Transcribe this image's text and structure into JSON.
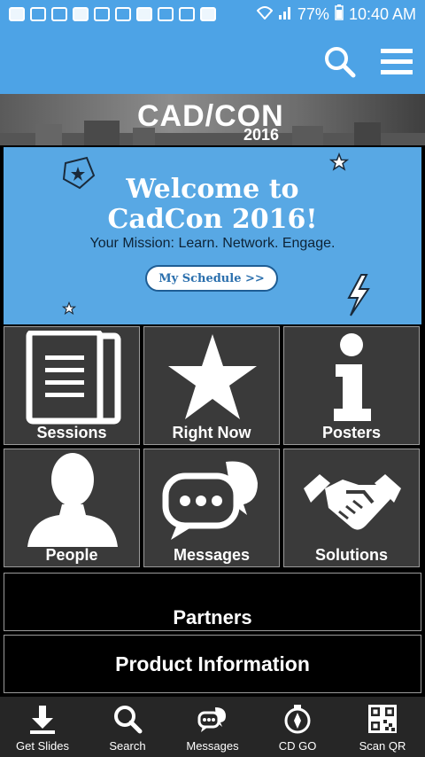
{
  "status": {
    "battery": "77%",
    "time": "10:40 AM"
  },
  "banner": {
    "logo": "CAD/CON",
    "year": "2016"
  },
  "welcome": {
    "title_line1": "Welcome to",
    "title_line2": "CadCon 2016!",
    "subtitle": "Your Mission: Learn. Network. Engage.",
    "button": "My Schedule >>"
  },
  "tiles": [
    {
      "label": "Sessions",
      "icon": "documents-icon"
    },
    {
      "label": "Right Now",
      "icon": "star-icon"
    },
    {
      "label": "Posters",
      "icon": "info-icon"
    },
    {
      "label": "People",
      "icon": "person-icon"
    },
    {
      "label": "Messages",
      "icon": "chat-icon"
    },
    {
      "label": "Solutions",
      "icon": "handshake-icon"
    }
  ],
  "bars": {
    "partners": "Partners",
    "product_info": "Product Information"
  },
  "bottom_nav": [
    {
      "label": "Get Slides",
      "icon": "download-icon"
    },
    {
      "label": "Search",
      "icon": "search-icon"
    },
    {
      "label": "Messages",
      "icon": "chat-icon"
    },
    {
      "label": "CD GO",
      "icon": "compass-icon"
    },
    {
      "label": "Scan QR",
      "icon": "qr-icon"
    }
  ],
  "colors": {
    "accent": "#4da3e6",
    "welcome_bg": "#58a8e4",
    "tile_bg": "#3a3a3a",
    "nav_bg": "#262626"
  }
}
